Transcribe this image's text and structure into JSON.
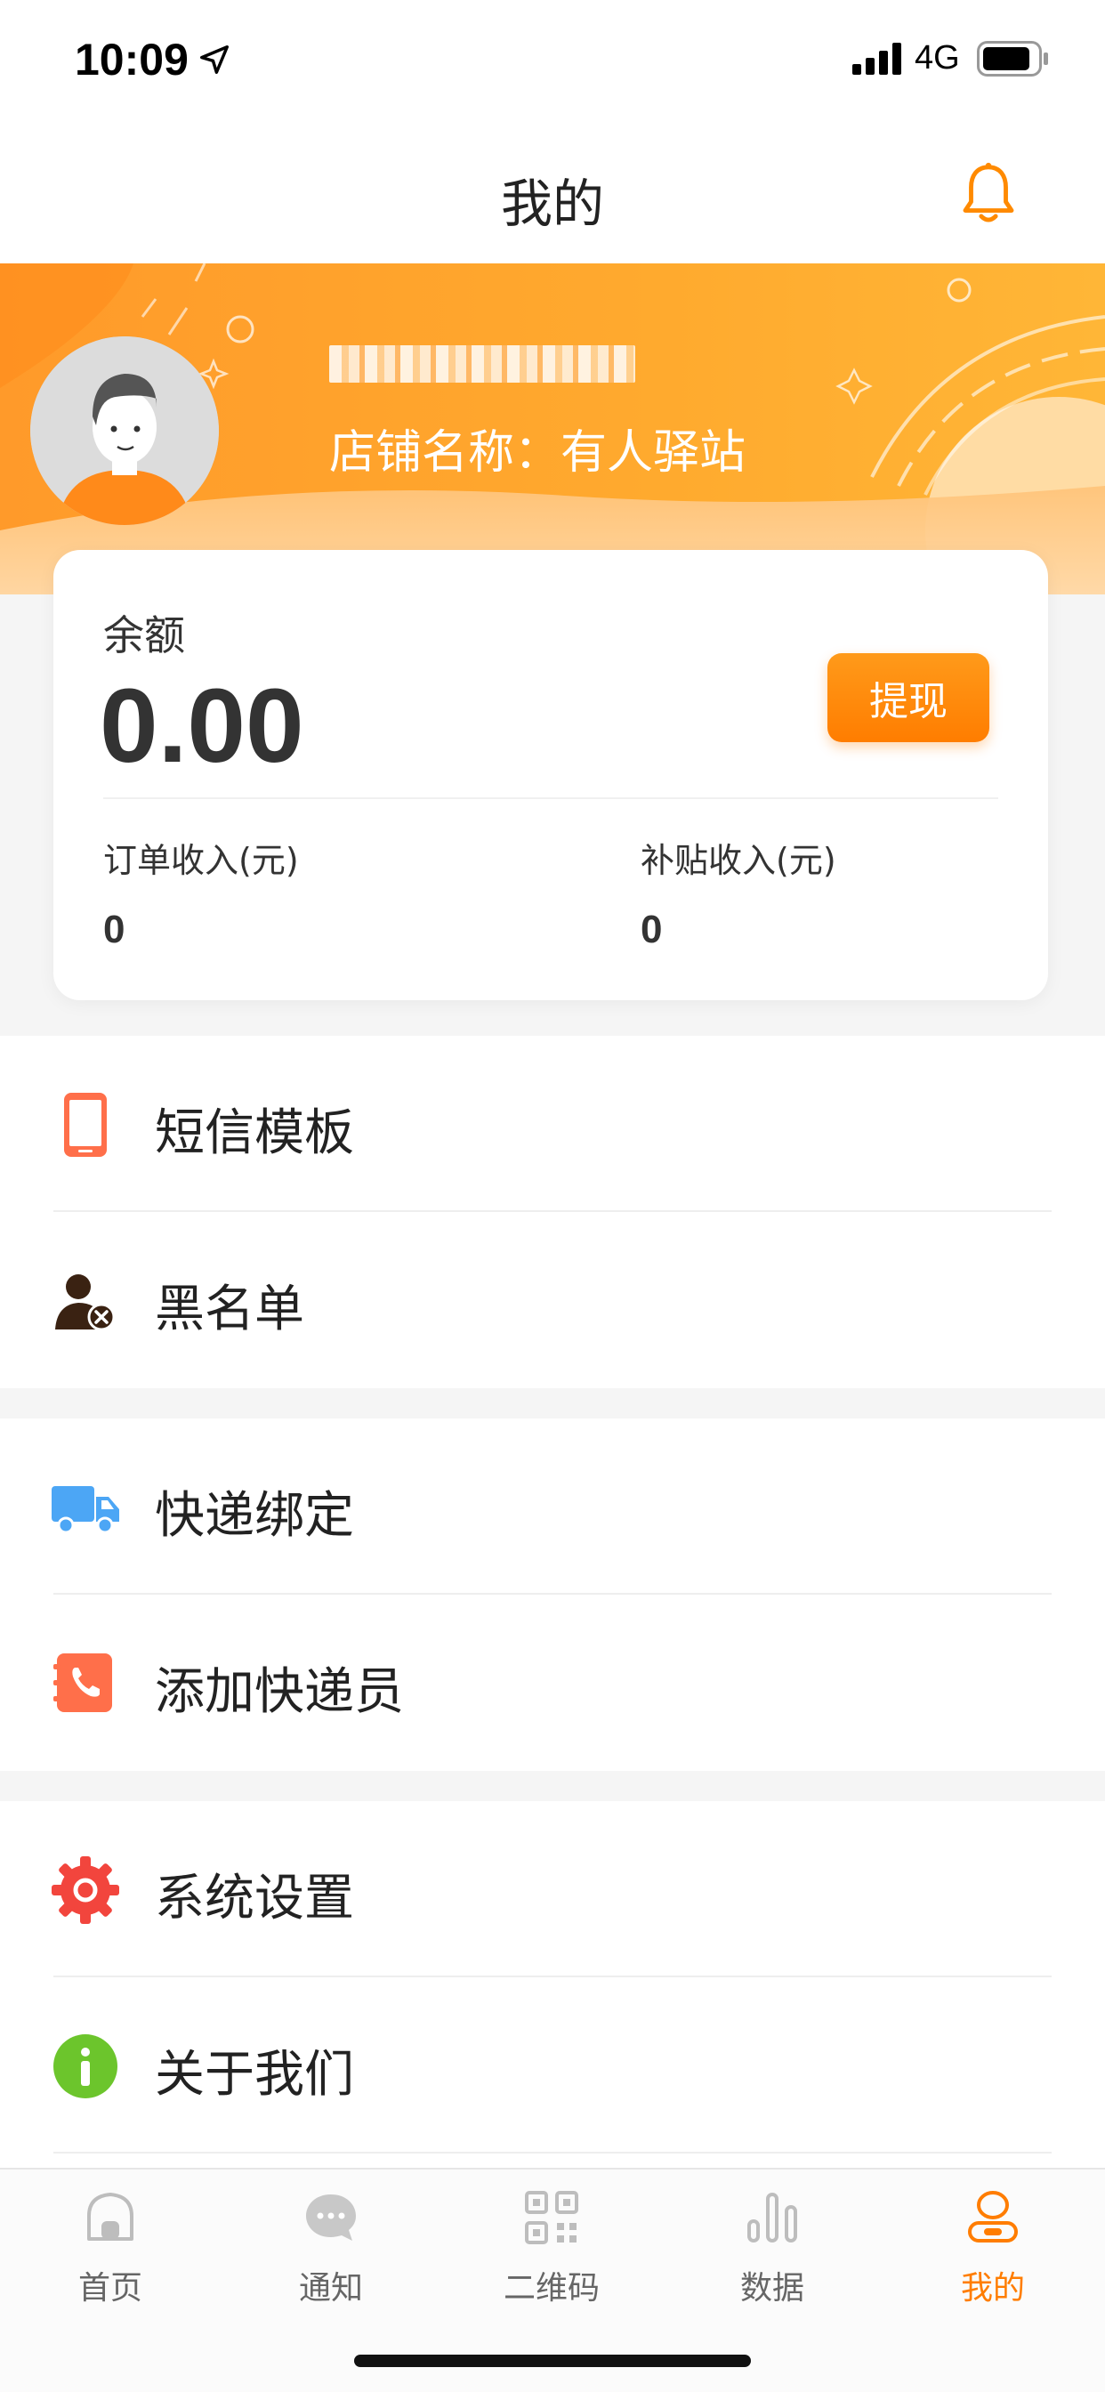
{
  "status_bar": {
    "time": "10:09",
    "network": "4G",
    "icons": [
      "location-arrow-icon",
      "signal-icon",
      "battery-icon"
    ]
  },
  "nav": {
    "title": "我的",
    "bell_icon": "bell-icon",
    "accent_color": "#ff8a00"
  },
  "profile": {
    "shop_name": "店铺名称：有人驿站",
    "avatar_icon": "user-avatar"
  },
  "balance": {
    "label": "余额",
    "value": "0.00",
    "withdraw_label": "提现",
    "order_income_label": "订单收入(元)",
    "order_income_value": "0",
    "subsidy_income_label": "补贴收入(元)",
    "subsidy_income_value": "0"
  },
  "menu": {
    "groups": [
      {
        "items": [
          {
            "label": "短信模板",
            "icon": "phone-icon",
            "color": "#ff6f4a"
          },
          {
            "label": "黑名单",
            "icon": "user-block-icon",
            "color": "#4a2a1a"
          }
        ]
      },
      {
        "items": [
          {
            "label": "快递绑定",
            "icon": "truck-icon",
            "color": "#4ca6f5"
          },
          {
            "label": "添加快递员",
            "icon": "contact-phone-icon",
            "color": "#ff6f4a"
          }
        ]
      },
      {
        "items": [
          {
            "label": "系统设置",
            "icon": "gear-icon",
            "color": "#f2453d"
          },
          {
            "label": "关于我们",
            "icon": "info-icon",
            "color": "#6cc52c"
          }
        ]
      }
    ]
  },
  "tab_bar": {
    "tabs": [
      {
        "label": "首页",
        "icon": "home-icon"
      },
      {
        "label": "通知",
        "icon": "chat-icon"
      },
      {
        "label": "二维码",
        "icon": "qr-code-icon"
      },
      {
        "label": "数据",
        "icon": "bar-chart-icon"
      },
      {
        "label": "我的",
        "icon": "user-icon",
        "active": true
      }
    ],
    "active_color": "#ff7d00"
  }
}
